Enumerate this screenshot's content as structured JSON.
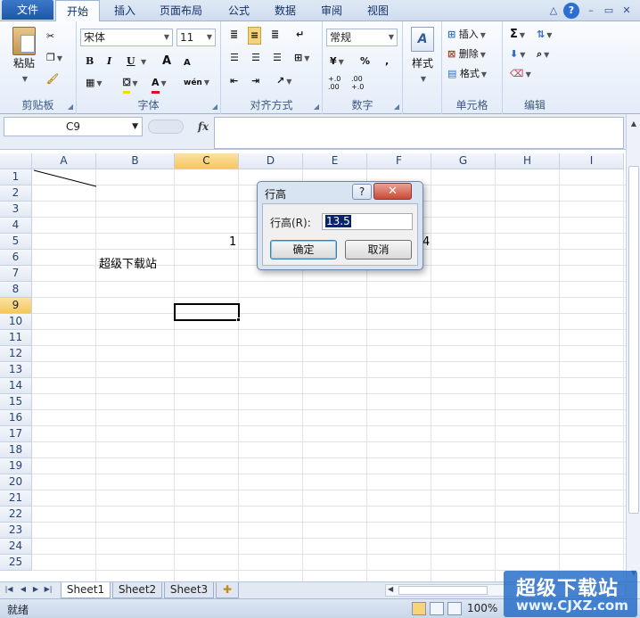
{
  "ribbon_tabs": [
    "文件",
    "开始",
    "插入",
    "页面布局",
    "公式",
    "数据",
    "审阅",
    "视图"
  ],
  "active_tab": "开始",
  "clipboard": {
    "paste": "粘贴",
    "group": "剪贴板"
  },
  "font": {
    "name": "宋体",
    "size": "11",
    "bold": "B",
    "italic": "I",
    "underline": "U",
    "grow": "A",
    "shrink": "A",
    "fontcolor": "A",
    "wen": "wén",
    "group": "字体"
  },
  "alignment": {
    "group": "对齐方式"
  },
  "number": {
    "format": "常规",
    "percent": "%",
    "comma": ",",
    "inc": "+.0 .00",
    "dec": ".00 +.0",
    "group": "数字"
  },
  "styles": {
    "label": "样式"
  },
  "cells": {
    "insert": "插入",
    "delete": "删除",
    "format": "格式",
    "group": "单元格"
  },
  "editing": {
    "sum": "Σ",
    "group": "编辑"
  },
  "formula_bar": {
    "name_box": "C9",
    "fx": "fx",
    "value": ""
  },
  "columns": [
    "A",
    "B",
    "C",
    "D",
    "E",
    "F",
    "G",
    "H",
    "I"
  ],
  "rows": [
    "1",
    "2",
    "3",
    "4",
    "5",
    "6",
    "7",
    "8",
    "9",
    "10",
    "11",
    "12",
    "13",
    "14",
    "15",
    "16",
    "17",
    "18",
    "19",
    "20",
    "21",
    "22",
    "23",
    "24",
    "25"
  ],
  "selected_cell": "C9",
  "cell_values": {
    "C5": "1",
    "F5": "4",
    "B6": "超级下载站"
  },
  "dialog": {
    "title": "行高",
    "help": "?",
    "close": "✕",
    "label": "行高(R):",
    "value": "13.5",
    "ok": "确定",
    "cancel": "取消"
  },
  "sheets": [
    "Sheet1",
    "Sheet2",
    "Sheet3"
  ],
  "active_sheet": "Sheet1",
  "status": {
    "ready": "就绪",
    "zoom": "100%"
  },
  "watermark": {
    "cn": "超级下载站",
    "url": "www.CJXZ.com"
  }
}
